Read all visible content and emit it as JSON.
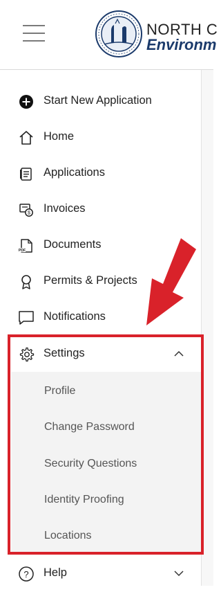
{
  "header": {
    "menu_icon": "hamburger-menu-icon",
    "seal_icon": "state-seal-logo",
    "brand_line1": "NORTH C",
    "brand_line2": "Environm"
  },
  "sidebar": {
    "items": [
      {
        "label": "Start New Application",
        "icon": "plus-circle-icon"
      },
      {
        "label": "Home",
        "icon": "home-icon"
      },
      {
        "label": "Applications",
        "icon": "applications-icon"
      },
      {
        "label": "Invoices",
        "icon": "invoice-icon"
      },
      {
        "label": "Documents",
        "icon": "pdf-document-icon"
      },
      {
        "label": "Permits & Projects",
        "icon": "permit-badge-icon"
      },
      {
        "label": "Notifications",
        "icon": "notification-message-icon"
      },
      {
        "label": "Settings",
        "icon": "gear-icon",
        "expanded": true
      },
      {
        "label": "Help",
        "icon": "help-circle-icon",
        "expanded": false
      }
    ],
    "settings_sub": [
      {
        "label": "Profile"
      },
      {
        "label": "Change Password"
      },
      {
        "label": "Security Questions"
      },
      {
        "label": "Identity Proofing"
      },
      {
        "label": "Locations"
      }
    ]
  },
  "annotation": {
    "highlight_color": "#d9222a"
  }
}
